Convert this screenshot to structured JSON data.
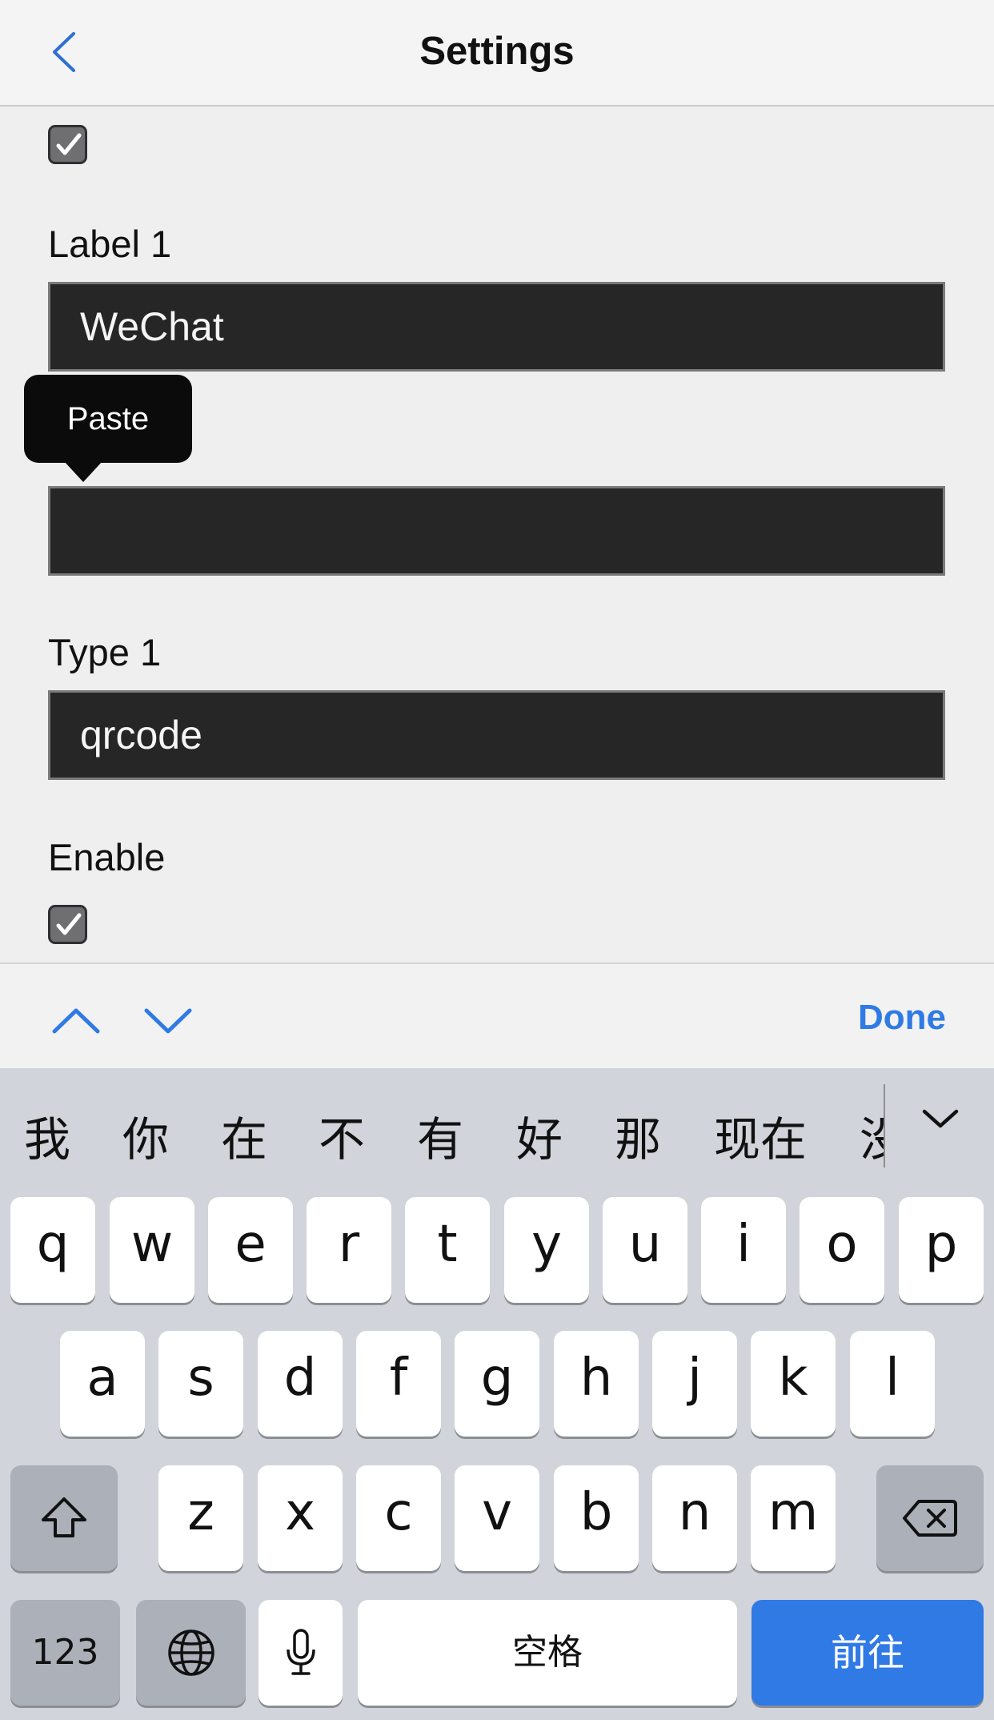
{
  "header": {
    "title": "Settings",
    "back_icon": "chevron-left-icon"
  },
  "form": {
    "checkbox_top_checked": true,
    "label1_title": "Label 1",
    "label1_value": "WeChat",
    "value1_value": "",
    "type1_title": "Type 1",
    "type1_value": "qrcode",
    "enable_title": "Enable",
    "enable_checked": true
  },
  "context_menu": {
    "paste_label": "Paste"
  },
  "accessory": {
    "prev_icon": "chevron-up-icon",
    "next_icon": "chevron-down-icon",
    "done_label": "Done"
  },
  "keyboard": {
    "candidates": [
      "我",
      "你",
      "在",
      "不",
      "有",
      "好",
      "那",
      "现在",
      "没"
    ],
    "row1": [
      "q",
      "w",
      "e",
      "r",
      "t",
      "y",
      "u",
      "i",
      "o",
      "p"
    ],
    "row2": [
      "a",
      "s",
      "d",
      "f",
      "g",
      "h",
      "j",
      "k",
      "l"
    ],
    "row3": [
      "z",
      "x",
      "c",
      "v",
      "b",
      "n",
      "m"
    ],
    "numbers_label": "123",
    "space_label": "空格",
    "go_label": "前往",
    "accent_color": "#2f7ae5"
  }
}
